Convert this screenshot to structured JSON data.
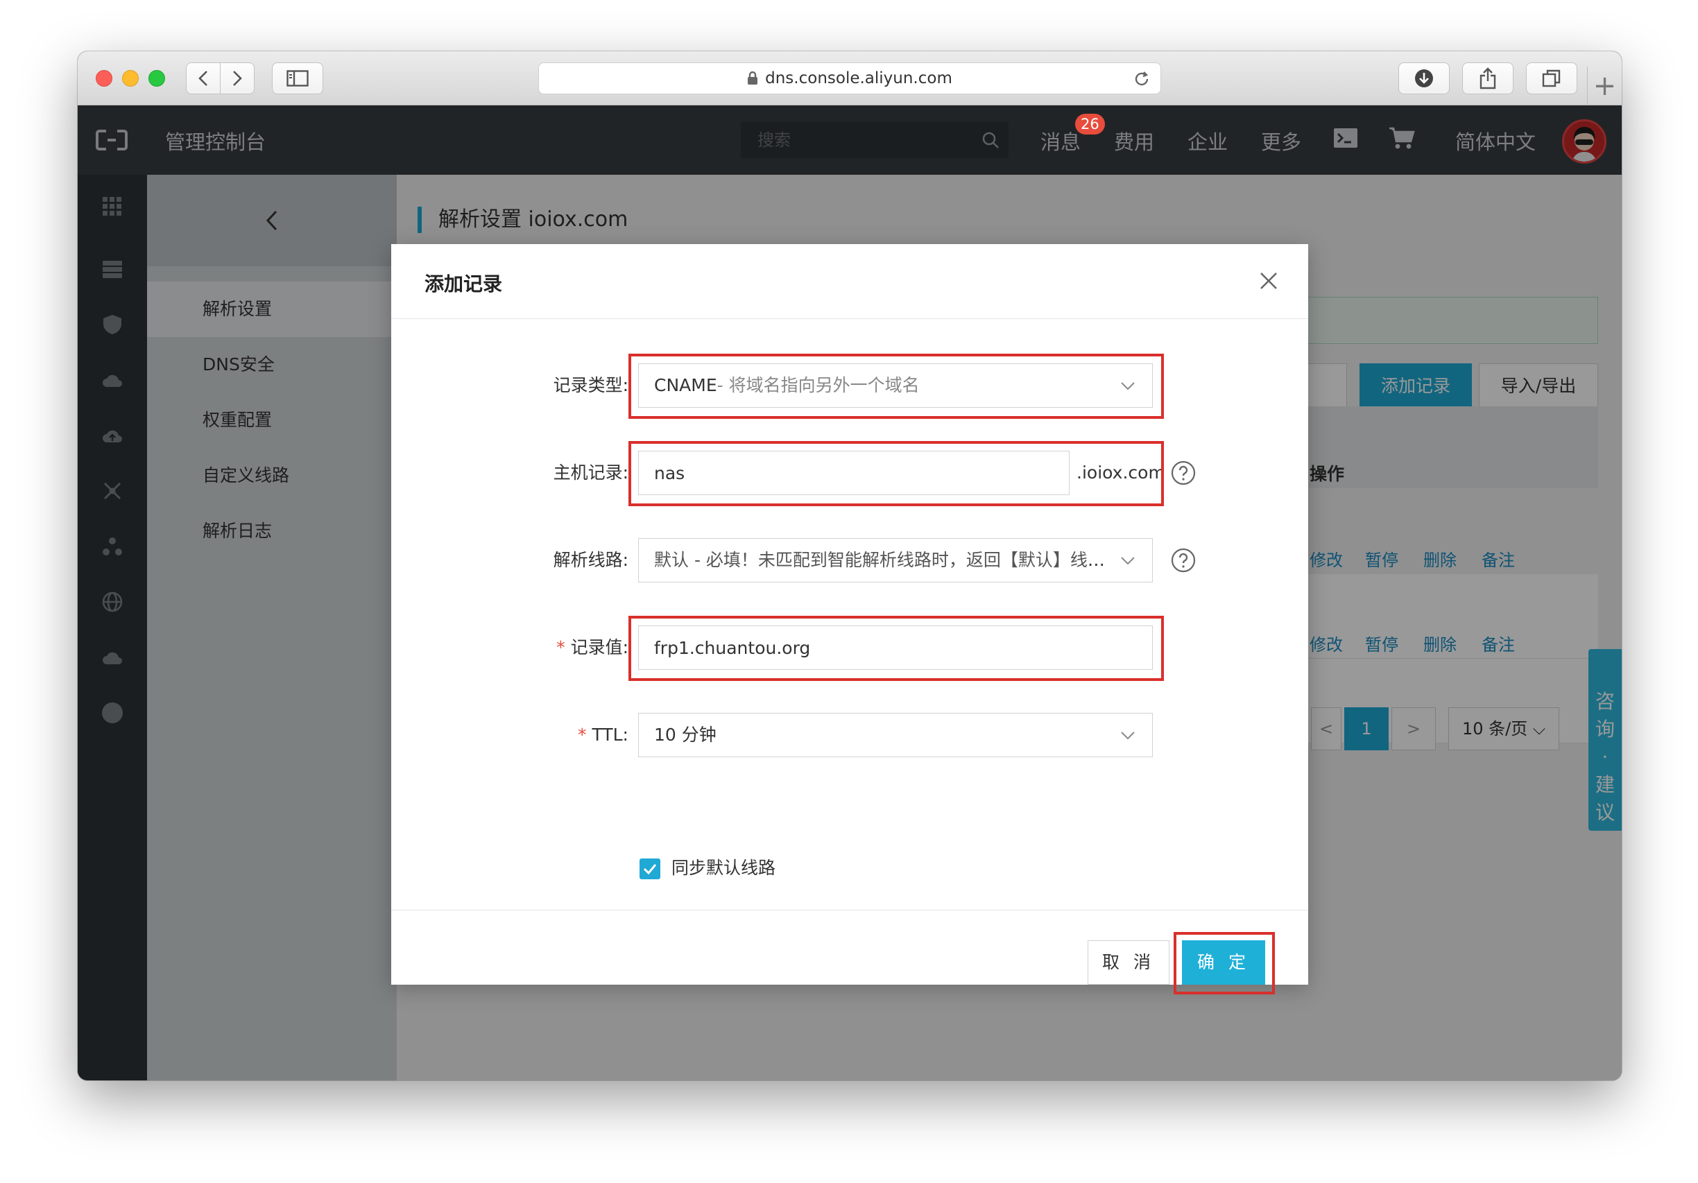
{
  "browser": {
    "url": "dns.console.aliyun.com"
  },
  "topbar": {
    "title": "管理控制台",
    "search_placeholder": "搜索",
    "nav": {
      "messages": "消息",
      "messages_badge": "26",
      "billing": "费用",
      "enterprise": "企业",
      "more": "更多",
      "language": "简体中文"
    }
  },
  "subnav": {
    "items": [
      {
        "label": "解析设置"
      },
      {
        "label": "DNS安全"
      },
      {
        "label": "权重配置"
      },
      {
        "label": "自定义线路"
      },
      {
        "label": "解析日志"
      }
    ]
  },
  "main": {
    "page_title": "解析设置 ioiox.com",
    "add_record_button": "添加记录",
    "import_export_button": "导入/导出",
    "actions_header": "操作",
    "row_actions": [
      "修改",
      "暂停",
      "删除",
      "备注"
    ],
    "pager": {
      "current": "1",
      "page_size": "10 条/页"
    },
    "side_tab": "咨询·建议"
  },
  "dialog": {
    "title": "添加记录",
    "record_type": {
      "label": "记录类型:",
      "value": "CNAME",
      "hint": "- 将域名指向另外一个域名"
    },
    "host": {
      "label": "主机记录:",
      "value": "nas",
      "suffix": ".ioiox.com"
    },
    "line": {
      "label": "解析线路:",
      "value": "默认 - 必填！未匹配到智能解析线路时，返回【默认】线路..."
    },
    "record_value": {
      "label": "记录值:",
      "value": "frp1.chuantou.org"
    },
    "ttl": {
      "label": "TTL:",
      "value": "10 分钟"
    },
    "sync_default": {
      "label": "同步默认线路",
      "checked": true
    },
    "cancel": "取 消",
    "confirm": "确 定"
  },
  "colors": {
    "accent": "#1fb0d8",
    "highlight": "#d9302c",
    "topbar": "#373d41"
  }
}
